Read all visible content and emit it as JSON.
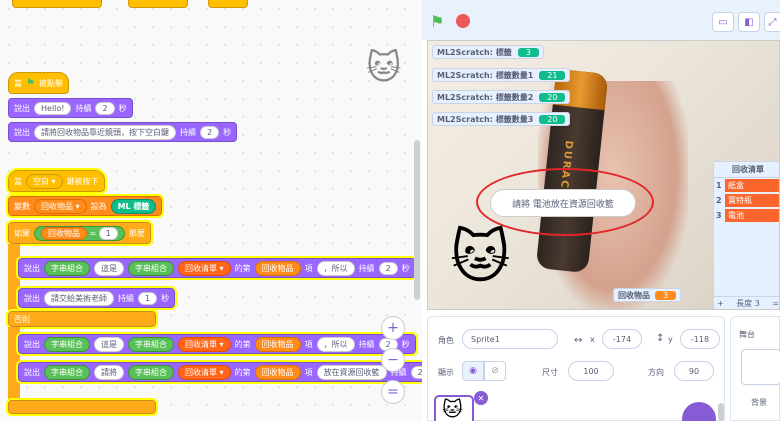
{
  "code": {
    "flag_hat": {
      "label": "當",
      "suffix": "被點擊"
    },
    "say1": {
      "say": "說出",
      "text": "Hello!",
      "for": "持續",
      "secs": "2",
      "unit": "秒"
    },
    "say2": {
      "say": "說出",
      "text": "請將回收物品靠近鏡頭，按下空白鍵",
      "for": "持續",
      "secs": "2",
      "unit": "秒"
    },
    "key_hat": {
      "label": "當",
      "key": "空白 ▾",
      "suffix": "鍵被按下"
    },
    "set_var": {
      "set": "變數",
      "var": "回收物品 ▾",
      "to": "設為",
      "ml": "ML",
      "label": "標籤"
    },
    "if": {
      "if": "如果",
      "var": "回收物品",
      "eq": "=",
      "val": "1",
      "then": "那麼"
    },
    "say3": {
      "say": "說出",
      "join1": "字串組合",
      "w1": "這是",
      "join2": "字串組合",
      "list": "回收清單 ▾",
      "of": "的第",
      "item": "回收物品",
      "item_suffix": "項",
      "tail": "，所以",
      "for": "持續",
      "secs": "2",
      "unit": "秒"
    },
    "say4": {
      "say": "說出",
      "text": "請交給美術老師",
      "for": "持續",
      "secs": "1",
      "unit": "秒"
    },
    "else": "否則",
    "say5": {
      "say": "說出",
      "join1": "字串組合",
      "w1": "這是",
      "join2": "字串組合",
      "list": "回收清單 ▾",
      "of": "的第",
      "item": "回收物品",
      "item_suffix": "項",
      "tail": "，所以",
      "for": "持續",
      "secs": "2",
      "unit": "秒"
    },
    "say6": {
      "say": "說出",
      "join1": "字串組合",
      "w1": "請將",
      "join2": "字串組合",
      "list": "回收清單 ▾",
      "of": "的第",
      "item": "回收物品",
      "item_suffix": "項",
      "tail": "放在資源回收籃",
      "for": "持續",
      "secs": "2"
    }
  },
  "zoom": {
    "in": "+",
    "out": "−",
    "reset": "="
  },
  "stage": {
    "monitors": [
      {
        "label": "ML2Scratch: 標籤",
        "value": "3"
      },
      {
        "label": "ML2Scratch: 標籤數量1",
        "value": "21"
      },
      {
        "label": "ML2Scratch: 標籤數量2",
        "value": "20"
      },
      {
        "label": "ML2Scratch: 標籤數量3",
        "value": "20"
      }
    ],
    "speech": "請將 電池放在資源回收籃",
    "list": {
      "title": "回收清單",
      "items": [
        {
          "index": "1",
          "value": "紙盒"
        },
        {
          "index": "2",
          "value": "寶特瓶"
        },
        {
          "index": "3",
          "value": "電池"
        }
      ],
      "add": "+",
      "length_label": "長度 3",
      "eq": "="
    },
    "var_monitor": {
      "label": "回收物品",
      "value": "3"
    },
    "battery_text": "DURACELL"
  },
  "sprite": {
    "sprite_label": "角色",
    "sprite_name": "Sprite1",
    "x_label": "x",
    "x": "-174",
    "y_label": "y",
    "y": "-118",
    "show_label": "顯示",
    "size_label": "尺寸",
    "size": "100",
    "direction_label": "方向",
    "direction": "90"
  },
  "stage_pane": {
    "label": "舞台",
    "backdrops": "背景"
  }
}
